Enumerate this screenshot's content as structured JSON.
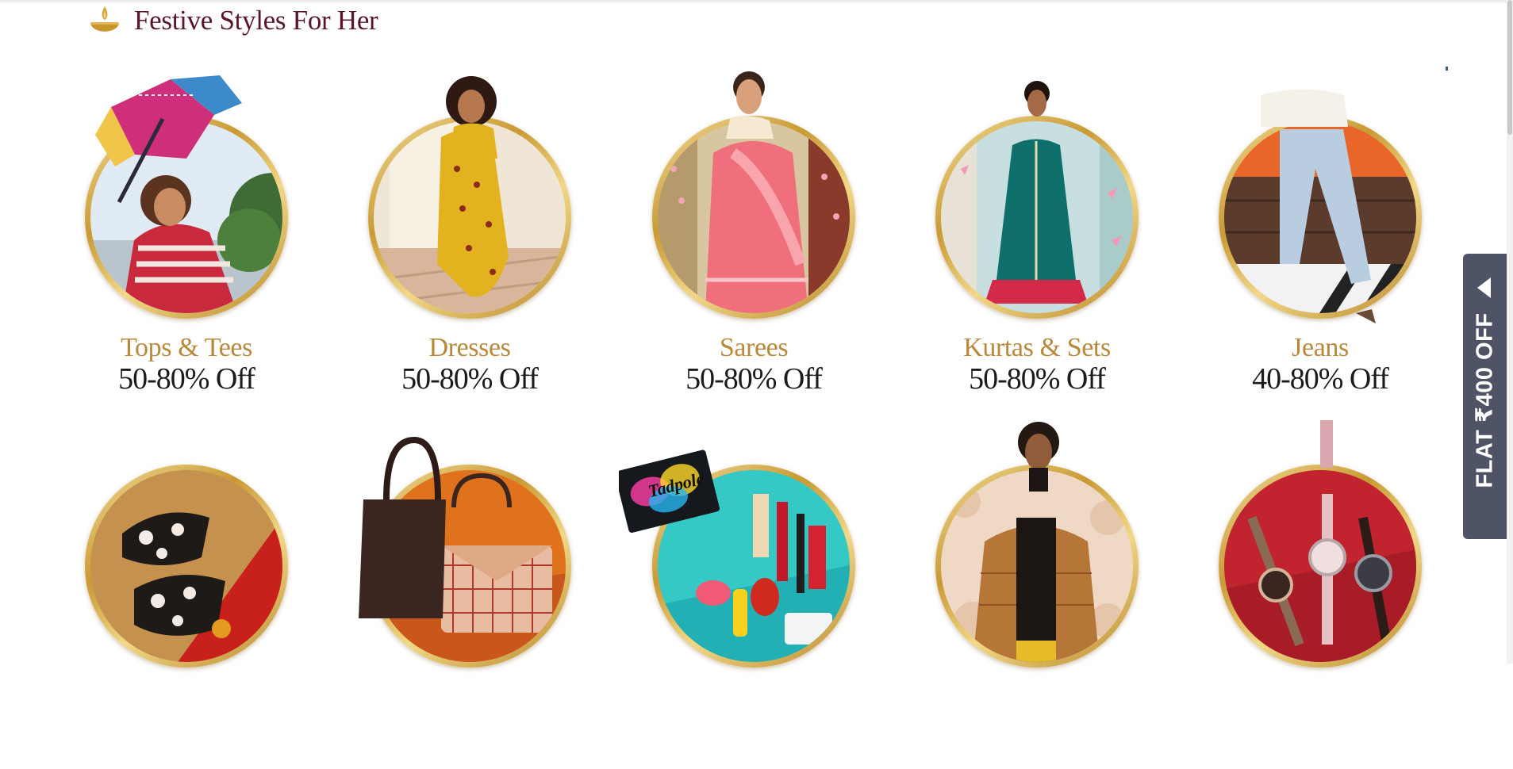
{
  "section": {
    "title": "Festive Styles For Her",
    "icon": "diya-icon"
  },
  "rows": [
    [
      {
        "id": "tops",
        "name": "Tops & Tees",
        "discount": "50-80% Off"
      },
      {
        "id": "dresses",
        "name": "Dresses",
        "discount": "50-80% Off"
      },
      {
        "id": "sarees",
        "name": "Sarees",
        "discount": "50-80% Off"
      },
      {
        "id": "kurtas",
        "name": "Kurtas & Sets",
        "discount": "50-80% Off"
      },
      {
        "id": "jeans",
        "name": "Jeans",
        "discount": "40-80% Off"
      }
    ],
    [
      {
        "id": "footwear"
      },
      {
        "id": "handbags"
      },
      {
        "id": "beauty",
        "palette_text": "Tadpole"
      },
      {
        "id": "jackets"
      },
      {
        "id": "watches"
      }
    ]
  ],
  "side_tab": {
    "label": "FLAT ₹400 OFF",
    "arrow_icon": "chevron-left-icon"
  },
  "colors": {
    "title": "#5a1526",
    "category": "#b8893b",
    "discount": "#1b1b1b",
    "ring": "#d4a94a",
    "tab": "#4e5465"
  }
}
